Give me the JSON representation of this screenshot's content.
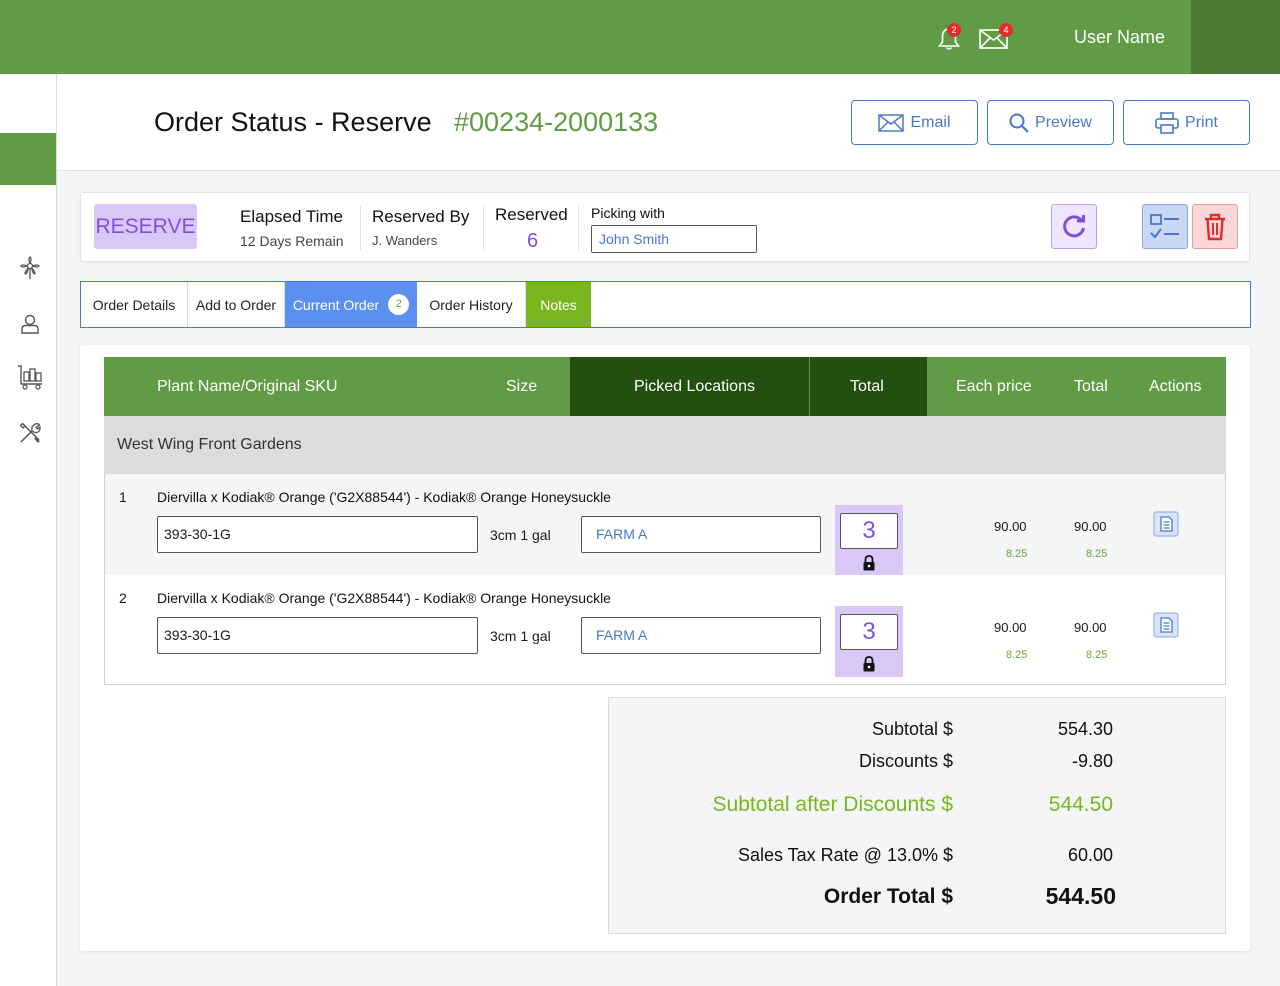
{
  "topbar": {
    "user_name": "User Name",
    "notifications_count": "2",
    "messages_count": "4"
  },
  "sidebar": {
    "items": [
      {
        "icon": "plant-icon"
      },
      {
        "icon": "user-icon"
      },
      {
        "icon": "cart-icon"
      },
      {
        "icon": "tools-icon"
      }
    ]
  },
  "header": {
    "title": "Order Status - Reserve",
    "order_number": "#00234-2000133",
    "email_label": "Email",
    "preview_label": "Preview",
    "print_label": "Print"
  },
  "status": {
    "badge": "RESERVE",
    "elapsed_label": "Elapsed Time",
    "elapsed_value": "12 Days Remain",
    "reserved_by_label": "Reserved By",
    "reserved_by_value": "J. Wanders",
    "reserved_label": "Reserved",
    "reserved_value": "6",
    "picking_label": "Picking with",
    "picking_value": "John Smith"
  },
  "tabs": [
    {
      "label": "Order Details"
    },
    {
      "label": "Add to Order"
    },
    {
      "label": "Current Order",
      "count": "2"
    },
    {
      "label": "Order History"
    },
    {
      "label": "Notes"
    }
  ],
  "table": {
    "headers": {
      "plant": "Plant Name/Original SKU",
      "size": "Size",
      "picked": "Picked Locations",
      "total_qty": "Total",
      "each": "Each price",
      "total": "Total",
      "actions": "Actions"
    },
    "group": "West Wing Front Gardens",
    "rows": [
      {
        "index": "1",
        "name": "Diervilla x Kodiak® Orange ('G2X88544') - Kodiak® Orange Honeysuckle",
        "sku": "393-30-1G",
        "size": "3cm 1 gal",
        "location": "FARM A",
        "qty": "3",
        "each_price": "90.00",
        "each_sub": "8.25",
        "total": "90.00",
        "total_sub": "8.25"
      },
      {
        "index": "2",
        "name": "Diervilla x Kodiak® Orange ('G2X88544') - Kodiak® Orange Honeysuckle",
        "sku": "393-30-1G",
        "size": "3cm 1 gal",
        "location": "FARM A",
        "qty": "3",
        "each_price": "90.00",
        "each_sub": "8.25",
        "total": "90.00",
        "total_sub": "8.25"
      }
    ]
  },
  "totals": {
    "subtotal_label": "Subtotal  $",
    "subtotal_value": "554.30",
    "discounts_label": "Discounts  $",
    "discounts_value": "-9.80",
    "after_label": "Subtotal after Discounts $",
    "after_value": "544.50",
    "tax_label": "Sales Tax Rate @ 13.0% $",
    "tax_value": "60.00",
    "order_total_label": "Order Total $",
    "order_total_value": "544.50"
  },
  "colors": {
    "primary_green": "#629b45",
    "dark_green": "#234f10",
    "accent_lime": "#6aa82a",
    "blue": "#4a78c9",
    "purple": "#8150d9",
    "lavender": "#d9c8f7",
    "danger": "#e12d2d"
  }
}
